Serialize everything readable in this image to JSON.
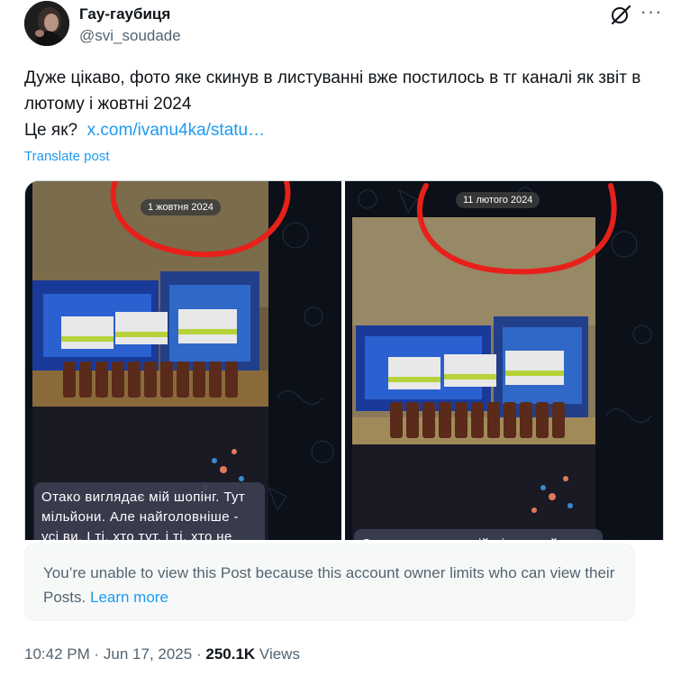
{
  "author": {
    "display_name": "Гау-гаубиця",
    "handle": "@svi_soudade"
  },
  "post": {
    "text_line1": "Дуже цікаво, фото яке скинув в листуванні вже постилось в тг каналі як звіт в лютому і жовтні 2024",
    "text_line2_prefix": "Це як?",
    "link": "x.com/ivanu4ka/statu…",
    "translate_label": "Translate post"
  },
  "media": {
    "left": {
      "date_chip": "1 жовтня 2024",
      "caption": "Отако виглядає мій шопінг. Тут мільйони. Але найголовніше - усі ви. І ті, хто тут, і ті, хто не тут."
    },
    "right": {
      "date_chip": "11 лютого 2024",
      "caption": "Отако виглядає мій різдвяний"
    }
  },
  "notice": {
    "text": "You’re unable to view this Post because this account owner limits who can view their Posts.",
    "learn_more": "Learn more"
  },
  "meta": {
    "time": "10:42 PM",
    "sep1": "·",
    "date": "Jun 17, 2025",
    "sep2": "·",
    "views_count": "250.1K",
    "views_label": "Views"
  },
  "icons": {
    "grok": "grok-icon",
    "more": "more-icon"
  },
  "colors": {
    "link": "#1d9bf0",
    "secondary_text": "#536471",
    "annotation_red": "#e8201a"
  }
}
